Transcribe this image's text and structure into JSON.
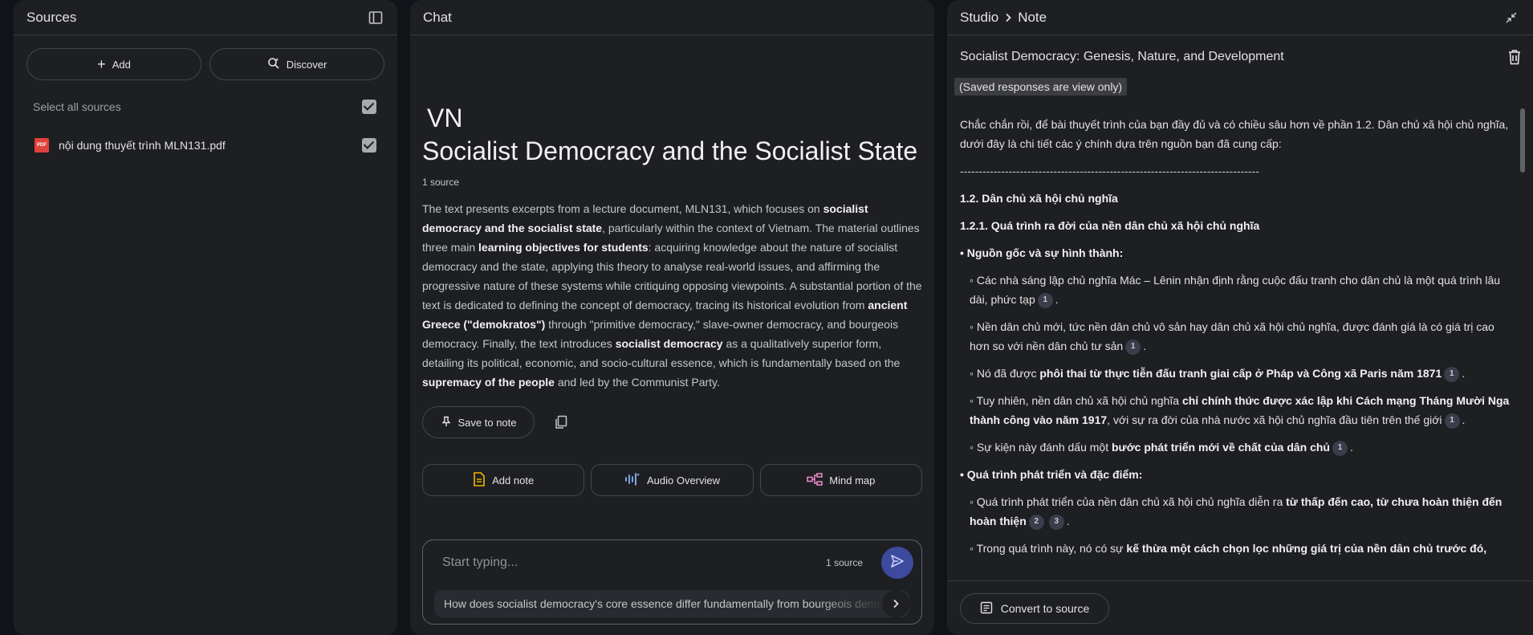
{
  "sources": {
    "title": "Sources",
    "add_label": "Add",
    "discover_label": "Discover",
    "select_all_label": "Select all sources",
    "items": [
      {
        "name": "nội dung thuyết trình MLN131.pdf",
        "type": "pdf"
      }
    ]
  },
  "chat": {
    "title": "Chat",
    "emoji": "VN",
    "heading": "Socialist Democracy and the Socialist State",
    "source_count": "1 source",
    "summary": [
      {
        "t": "The text presents excerpts from a lecture document, MLN131, which focuses on "
      },
      {
        "t": "socialist democracy and the socialist state",
        "b": true
      },
      {
        "t": ", particularly within the context of Vietnam. The material outlines three main "
      },
      {
        "t": "learning objectives for students",
        "b": true
      },
      {
        "t": ": acquiring knowledge about the nature of socialist democracy and the state, applying this theory to analyse real-world issues, and affirming the progressive nature of these systems while critiquing opposing viewpoints. A substantial portion of the text is dedicated to defining the concept of democracy, tracing its historical evolution from "
      },
      {
        "t": "ancient Greece (\"demokratos\")",
        "b": true
      },
      {
        "t": " through \"primitive democracy,\" slave-owner democracy, and bourgeois democracy. Finally, the text introduces "
      },
      {
        "t": "socialist democracy",
        "b": true
      },
      {
        "t": " as a qualitatively superior form, detailing its political, economic, and socio-cultural essence, which is fundamentally based on the "
      },
      {
        "t": "supremacy of the people",
        "b": true
      },
      {
        "t": " and led by the Communist Party."
      }
    ],
    "save_to_note": "Save to note",
    "add_note": "Add note",
    "audio_overview": "Audio Overview",
    "mind_map": "Mind map",
    "input_placeholder": "Start typing...",
    "input_source_count": "1 source",
    "suggestion": "How does socialist democracy's core essence differ fundamentally from bourgeois democracy?"
  },
  "studio": {
    "crumb_studio": "Studio",
    "crumb_note": "Note",
    "note_title": "Socialist Democracy: Genesis, Nature, and Development",
    "view_only": "(Saved responses are view only)",
    "convert_label": "Convert to source",
    "paragraphs": [
      {
        "style": "p",
        "parts": [
          {
            "t": "Chắc chắn rồi, để bài thuyết trình của bạn đầy đủ và có chiều sâu hơn về phần 1.2. Dân chủ xã hội chủ nghĩa, dưới đây là chi tiết các ý chính dựa trên nguồn bạn đã cung cấp:"
          }
        ]
      },
      {
        "style": "p",
        "parts": [
          {
            "t": "--------------------------------------------------------------------------------"
          }
        ]
      },
      {
        "style": "p",
        "parts": [
          {
            "t": "1.2. Dân chủ xã hội chủ nghĩa",
            "b": true
          }
        ]
      },
      {
        "style": "p",
        "parts": [
          {
            "t": "1.2.1. Quá trình ra đời của nền dân chủ xã hội chủ nghĩa",
            "b": true
          }
        ]
      },
      {
        "style": "p",
        "parts": [
          {
            "t": "• Nguồn gốc và sự hình thành:",
            "b": true
          }
        ]
      },
      {
        "style": "sub",
        "parts": [
          {
            "t": "◦ Các nhà sáng lập chủ nghĩa Mác – Lênin nhận định rằng cuộc đấu tranh cho dân chủ là một quá trình lâu dài, phức tạp"
          },
          {
            "c": "1"
          },
          {
            "t": "."
          }
        ]
      },
      {
        "style": "sub",
        "parts": [
          {
            "t": "◦ Nền dân chủ mới, tức nền dân chủ vô sản hay dân chủ xã hội chủ nghĩa, được đánh giá là có giá trị cao hơn so với nền dân chủ tư sản"
          },
          {
            "c": "1"
          },
          {
            "t": "."
          }
        ]
      },
      {
        "style": "sub",
        "parts": [
          {
            "t": "◦ Nó đã được "
          },
          {
            "t": "phôi thai từ thực tiễn đấu tranh giai cấp ở Pháp và Công xã Paris năm 1871",
            "b": true
          },
          {
            "c": "1"
          },
          {
            "t": "."
          }
        ]
      },
      {
        "style": "sub",
        "parts": [
          {
            "t": "◦ Tuy nhiên, nền dân chủ xã hội chủ nghĩa "
          },
          {
            "t": "chỉ chính thức được xác lập khi Cách mạng Tháng Mười Nga thành công vào năm 1917",
            "b": true
          },
          {
            "t": ", với sự ra đời của nhà nước xã hội chủ nghĩa đầu tiên trên thế giới"
          },
          {
            "c": "1"
          },
          {
            "t": "."
          }
        ]
      },
      {
        "style": "sub",
        "parts": [
          {
            "t": "◦ Sự kiện này đánh dấu một "
          },
          {
            "t": "bước phát triển mới về chất của dân chủ",
            "b": true
          },
          {
            "c": "1"
          },
          {
            "t": "."
          }
        ]
      },
      {
        "style": "p",
        "parts": [
          {
            "t": "• Quá trình phát triển và đặc điểm:",
            "b": true
          }
        ]
      },
      {
        "style": "sub",
        "parts": [
          {
            "t": "◦ Quá trình phát triển của nền dân chủ xã hội chủ nghĩa diễn ra "
          },
          {
            "t": "từ thấp đến cao, từ chưa hoàn thiện đến hoàn thiện",
            "b": true
          },
          {
            "c": "2"
          },
          {
            "c": "3"
          },
          {
            "t": "."
          }
        ]
      },
      {
        "style": "sub",
        "parts": [
          {
            "t": "◦ Trong quá trình này, nó có sự "
          },
          {
            "t": "kế thừa một cách chọn lọc những giá trị của nền dân chủ trước đó,",
            "b": true
          }
        ]
      }
    ]
  }
}
